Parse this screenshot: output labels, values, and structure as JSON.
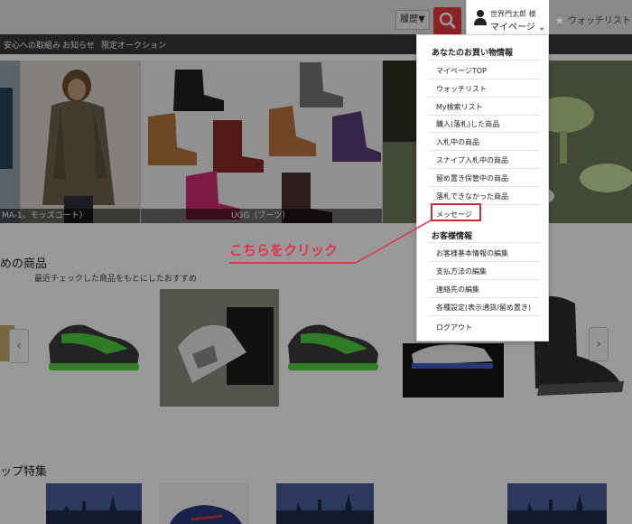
{
  "header": {
    "history_label": "履歴▼",
    "account_name": "世界門太郎 様",
    "account_link": "マイページ ⌄",
    "watchlist_label": "ウォッチリスト"
  },
  "nav": {
    "items": [
      "安心への取組み",
      "お知らせ",
      "限定オークション"
    ]
  },
  "hero": {
    "caption_left": "MA-1、モッズコート）",
    "caption_mid": "UGG（ブーツ）"
  },
  "recommend": {
    "title": "めの商品",
    "subtitle": "最近チェックした商品をもとにしたおすすめ"
  },
  "shop_feature": {
    "title": "ップ特集"
  },
  "dropdown": {
    "section1_title": "あなたのお買い物情報",
    "section1_items": [
      "マイページTOP",
      "ウォッチリスト",
      "My検索リスト",
      "購入(落札)した商品",
      "入札中の商品",
      "スナイプ入札中の商品",
      "留め置き保管中の商品",
      "落札できなかった商品",
      "メッセージ"
    ],
    "section2_title": "お客様情報",
    "section2_items": [
      "お客様基本情報の編集",
      "支払方法の編集",
      "連絡先の編集",
      "各種設定(表示通貨/留め置き)",
      "ログアウト"
    ]
  },
  "callout": {
    "text": "こちらをクリック"
  },
  "colors": {
    "search_button": "#e8393c",
    "highlight": "#c52f37",
    "callout": "#e2314b",
    "navbar": "#3a3a3a"
  }
}
